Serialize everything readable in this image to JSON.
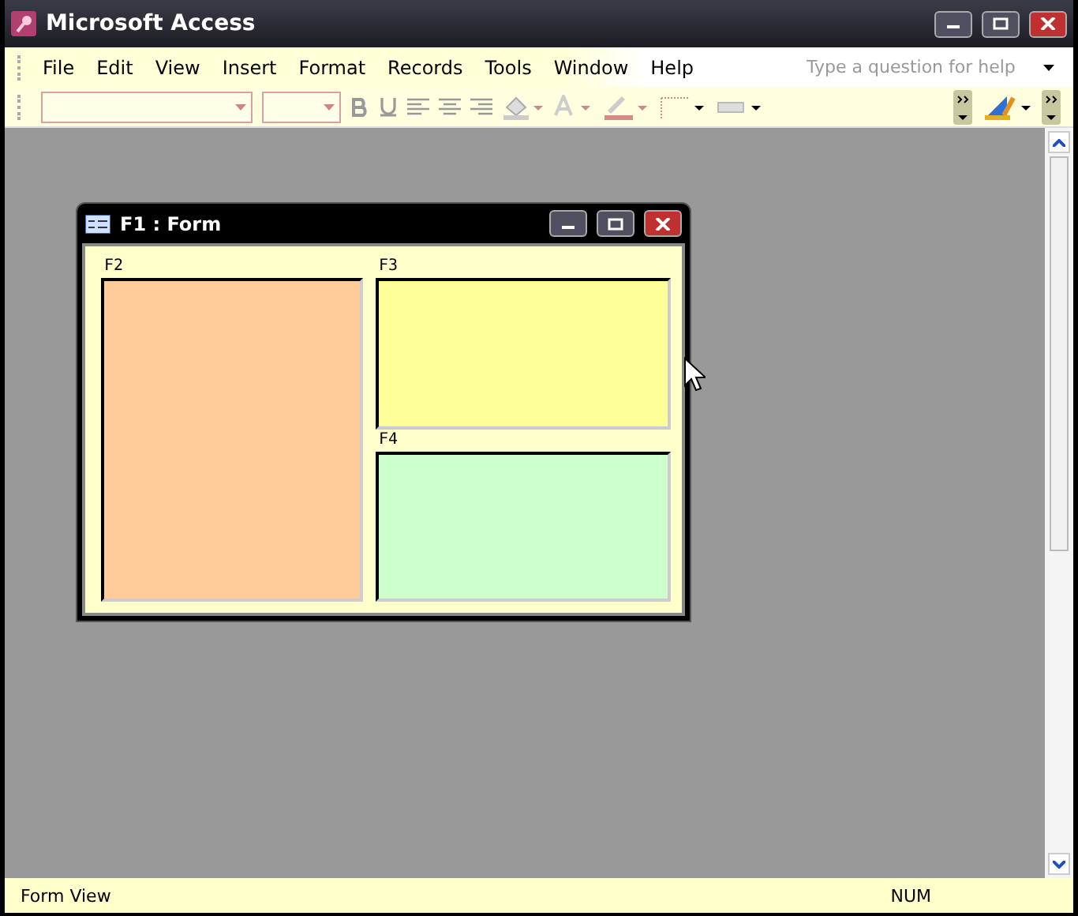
{
  "window": {
    "title": "Microsoft Access"
  },
  "menu": [
    "File",
    "Edit",
    "View",
    "Insert",
    "Format",
    "Records",
    "Tools",
    "Window",
    "Help"
  ],
  "help_box": {
    "placeholder": "Type a question for help"
  },
  "child_window": {
    "title": "F1 : Form",
    "subforms": [
      {
        "label": "F2",
        "color": "#ffcc99"
      },
      {
        "label": "F3",
        "color": "#ffff99"
      },
      {
        "label": "F4",
        "color": "#ccffcc"
      }
    ]
  },
  "status_bar": {
    "left": "Form View",
    "right": "NUM"
  }
}
